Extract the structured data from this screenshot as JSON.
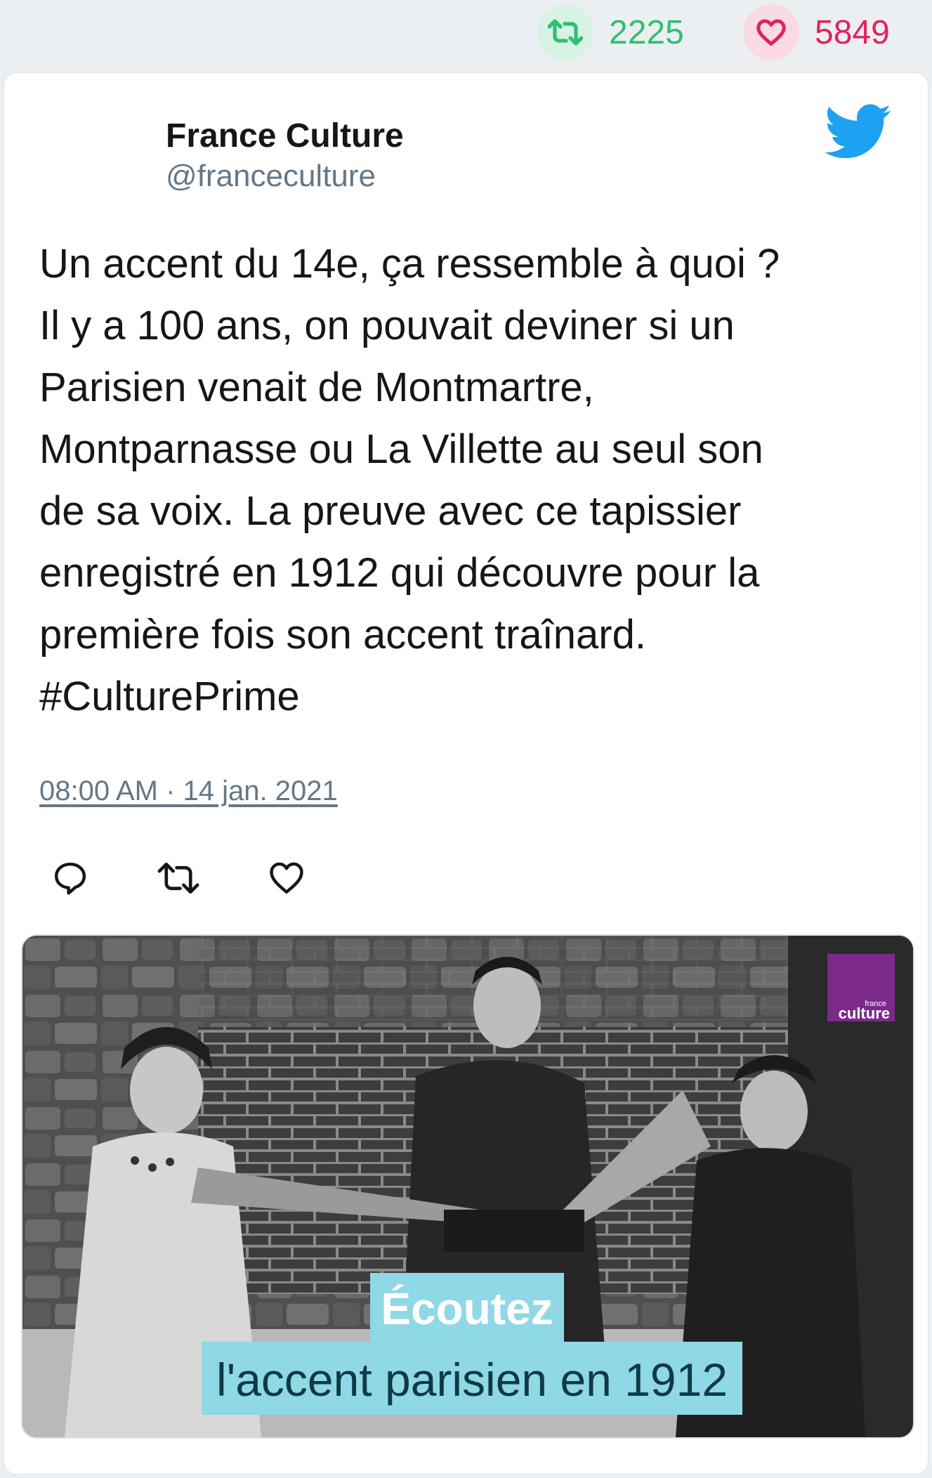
{
  "stats": {
    "retweets": "2225",
    "likes": "5849"
  },
  "tweet": {
    "author_name": "France Culture",
    "author_handle": "@franceculture",
    "text": "Un accent du 14e, ça ressemble à quoi ?\nIl y a 100 ans, on pouvait deviner si un\nParisien venait de Montmartre,\nMontparnasse ou La Villette au seul son\nde sa voix. La preuve avec ce tapissier\nenregistré en 1912 qui découvre pour la\npremière fois son accent traînard.\n#CulturePrime",
    "timestamp": "08:00 AM · 14 jan. 2021"
  },
  "media": {
    "logo_small": "france",
    "logo_big": "culture",
    "caption_line1": "Écoutez",
    "caption_line2": "l'accent parisien en 1912"
  },
  "colors": {
    "retweet": "#2fbf71",
    "like": "#e0245e",
    "twitter": "#1da1f2",
    "logo": "#7b2a8c",
    "caption_bg": "#8fd8e6"
  },
  "icons": [
    "retweet-icon",
    "heart-icon",
    "twitter-bird-icon",
    "reply-icon",
    "retweet-action-icon",
    "like-action-icon"
  ]
}
